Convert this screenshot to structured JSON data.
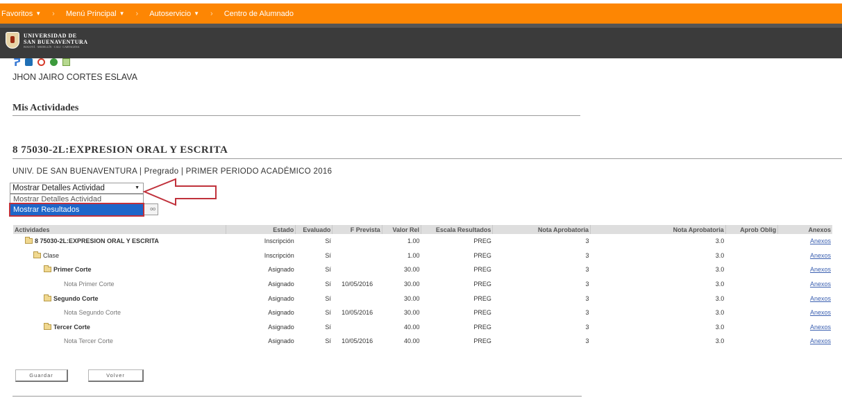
{
  "nav": {
    "items": [
      {
        "label": "Favoritos",
        "has_menu": true
      },
      {
        "label": "Menú Principal",
        "has_menu": true
      },
      {
        "label": "Autoservicio",
        "has_menu": true
      },
      {
        "label": "Centro de Alumnado",
        "has_menu": false
      }
    ],
    "separator": "›"
  },
  "logo": {
    "line1": "UNIVERSIDAD DE",
    "line2": "SAN BUENAVENTURA",
    "line3": "BOGOTÁ · MEDELLÍN · CALI · CARTAGENA"
  },
  "user": {
    "name": "JHON JAIRO CORTES ESLAVA"
  },
  "page": {
    "title": "Mis Actividades"
  },
  "course": {
    "title": "8 75030-2L:EXPRESION ORAL Y ESCRITA",
    "subtitle": "UNIV. DE SAN BUENAVENTURA | Pregrado | PRIMER PERIODO ACADÉMICO 2016"
  },
  "view_select": {
    "value": "Mostrar Detalles Actividad",
    "options": [
      "Mostrar Detalles Actividad",
      "Mostrar Resultados"
    ],
    "highlighted": "Mostrar Resultados"
  },
  "hidden_button_label": "oo",
  "table": {
    "headers": [
      "Actividades",
      "Estado",
      "Evaluado",
      "F Prevista",
      "Valor Rel",
      "Escala Resultados",
      "Nota Aprobatoria",
      "Nota Aprobatoria",
      "Aprob Oblig",
      "Anexos"
    ],
    "rows": [
      {
        "name": "8 75030-2L:EXPRESION ORAL Y ESCRITA",
        "level": 0,
        "folder": true,
        "bold": true,
        "estado": "Inscripción",
        "evaluado": "Sí",
        "fecha": "",
        "valor": "1.00",
        "escala": "PREG",
        "nota1": "3",
        "nota2": "3.0",
        "oblig": "",
        "anexo": "Anexos"
      },
      {
        "name": "Clase",
        "level": 1,
        "folder": true,
        "bold": false,
        "estado": "Inscripción",
        "evaluado": "Sí",
        "fecha": "",
        "valor": "1.00",
        "escala": "PREG",
        "nota1": "3",
        "nota2": "3.0",
        "oblig": "",
        "anexo": "Anexos"
      },
      {
        "name": "Primer Corte",
        "level": 2,
        "folder": true,
        "bold": true,
        "estado": "Asignado",
        "evaluado": "Sí",
        "fecha": "",
        "valor": "30.00",
        "escala": "PREG",
        "nota1": "3",
        "nota2": "3.0",
        "oblig": "",
        "anexo": "Anexos"
      },
      {
        "name": "Nota Primer Corte",
        "level": 3,
        "folder": false,
        "bold": false,
        "estado": "Asignado",
        "evaluado": "Sí",
        "fecha": "10/05/2016",
        "valor": "30.00",
        "escala": "PREG",
        "nota1": "3",
        "nota2": "3.0",
        "oblig": "",
        "anexo": "Anexos"
      },
      {
        "name": "Segundo Corte",
        "level": 2,
        "folder": true,
        "bold": true,
        "estado": "Asignado",
        "evaluado": "Sí",
        "fecha": "",
        "valor": "30.00",
        "escala": "PREG",
        "nota1": "3",
        "nota2": "3.0",
        "oblig": "",
        "anexo": "Anexos"
      },
      {
        "name": "Nota Segundo Corte",
        "level": 3,
        "folder": false,
        "bold": false,
        "estado": "Asignado",
        "evaluado": "Sí",
        "fecha": "10/05/2016",
        "valor": "30.00",
        "escala": "PREG",
        "nota1": "3",
        "nota2": "3.0",
        "oblig": "",
        "anexo": "Anexos"
      },
      {
        "name": "Tercer Corte",
        "level": 2,
        "folder": true,
        "bold": true,
        "estado": "Asignado",
        "evaluado": "Sí",
        "fecha": "",
        "valor": "40.00",
        "escala": "PREG",
        "nota1": "3",
        "nota2": "3.0",
        "oblig": "",
        "anexo": "Anexos"
      },
      {
        "name": "Nota Tercer Corte",
        "level": 3,
        "folder": false,
        "bold": false,
        "estado": "Asignado",
        "evaluado": "Sí",
        "fecha": "10/05/2016",
        "valor": "40.00",
        "escala": "PREG",
        "nota1": "3",
        "nota2": "3.0",
        "oblig": "",
        "anexo": "Anexos"
      }
    ]
  },
  "actions": {
    "save": "Guardar",
    "back": "Volver"
  },
  "colors": {
    "nav_bg": "#fd8603",
    "banner_bg": "#3b3b3b",
    "highlight": "#1e66c9",
    "annotation": "#c0313b"
  }
}
